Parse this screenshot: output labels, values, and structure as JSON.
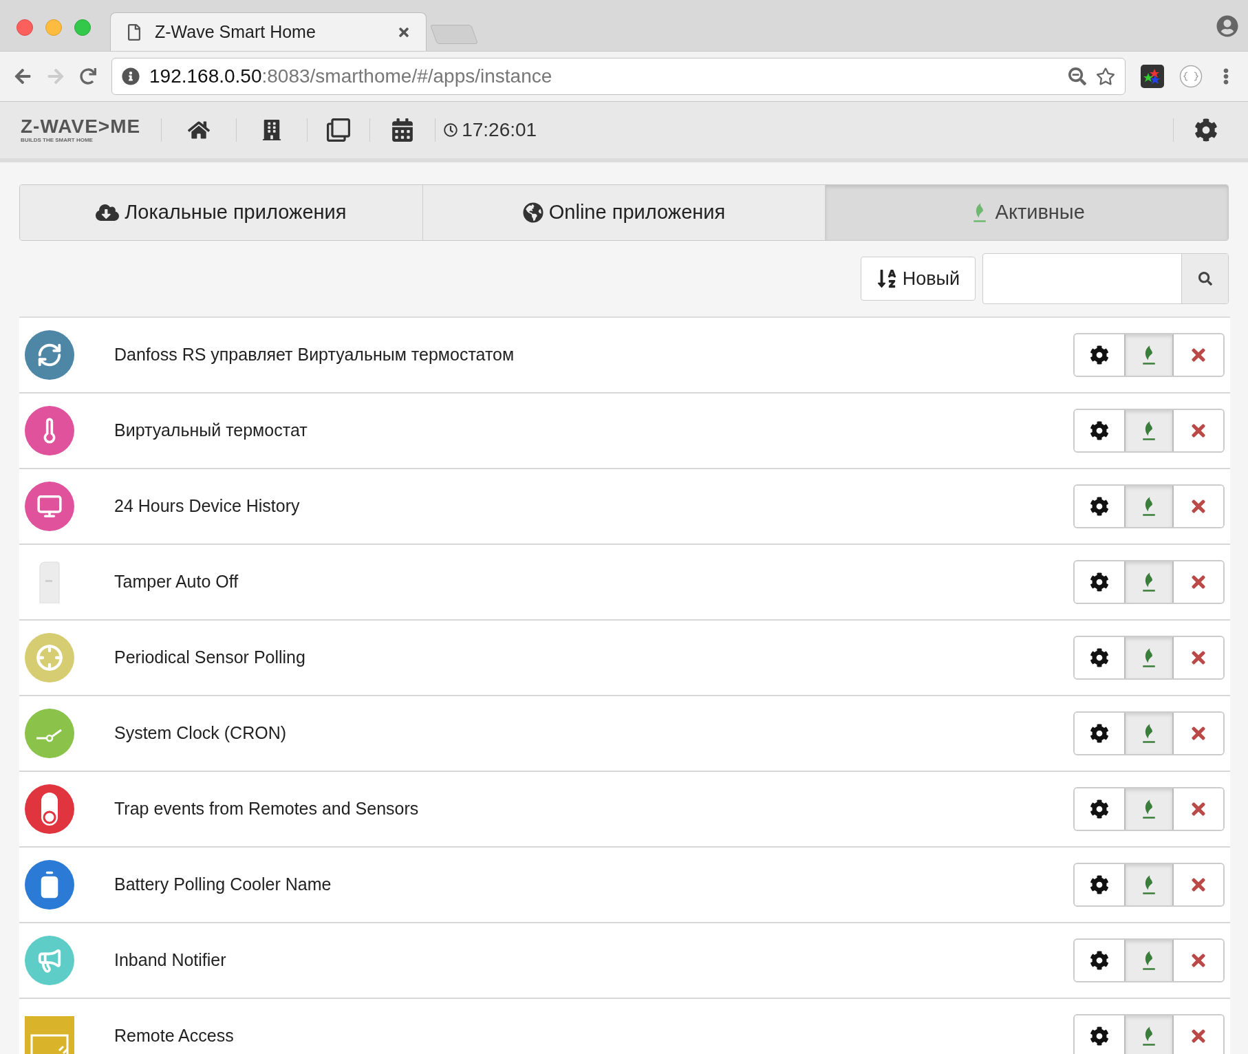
{
  "browser": {
    "tab_title": "Z-Wave Smart Home",
    "url_host": "192.168.0.50",
    "url_path": ":8083/smarthome/#/apps/instance"
  },
  "header": {
    "logo": "Z-WAVE>ME",
    "tagline": "BUILDS THE SMART HOME",
    "time": "17:26:01"
  },
  "tabs": [
    {
      "label": "Локальные приложения",
      "kind": "cloud",
      "selected": false
    },
    {
      "label": "Online приложения",
      "kind": "globe",
      "selected": false
    },
    {
      "label": "Активные",
      "kind": "flame",
      "selected": true
    }
  ],
  "sort_button": "Новый",
  "apps": [
    {
      "name": "Danfoss RS управляет Виртуальным термостатом",
      "kind": "sync",
      "color": "#4e86a6",
      "active": true
    },
    {
      "name": "Виртуальный термостат",
      "kind": "thermometer",
      "color": "#e0529c",
      "active": true
    },
    {
      "name": "24 Hours Device History",
      "kind": "monitor",
      "color": "#e0529c",
      "active": true
    },
    {
      "name": "Tamper Auto Off",
      "kind": "sensor",
      "color": "#ececec",
      "active": true
    },
    {
      "name": "Periodical Sensor Polling",
      "kind": "target",
      "color": "#d6cc72",
      "active": true
    },
    {
      "name": "System Clock (CRON)",
      "kind": "clock",
      "color": "#8bc34a",
      "active": true
    },
    {
      "name": "Trap events from Remotes and Sensors",
      "kind": "toggle",
      "color": "#e0343f",
      "active": true
    },
    {
      "name": "Battery Polling Cooler Name",
      "kind": "battery",
      "color": "#2a7ad6",
      "active": true
    },
    {
      "name": "Inband Notifier",
      "kind": "megaphone",
      "color": "#5fcdc7",
      "active": true
    },
    {
      "name": "Remote Access",
      "kind": "remote",
      "color": "#d9b42a",
      "active": true
    }
  ]
}
